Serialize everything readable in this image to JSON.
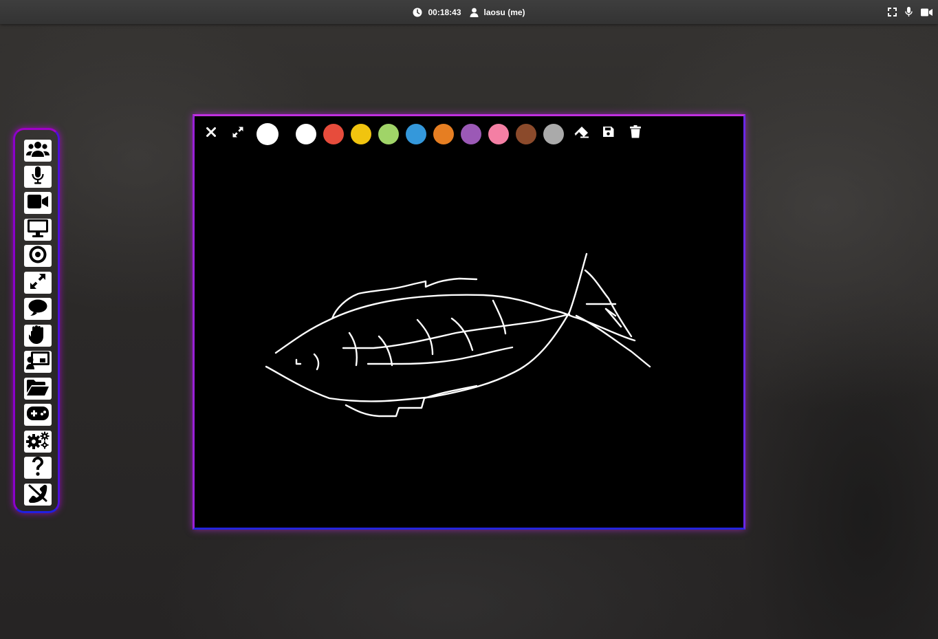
{
  "header": {
    "timer": "00:18:43",
    "user": "laosu (me)",
    "icons": [
      "clock-icon",
      "user-icon",
      "fullscreen-icon",
      "microphone-icon",
      "video-camera-icon"
    ]
  },
  "sidebar": {
    "items": [
      {
        "name": "participants-icon"
      },
      {
        "name": "microphone-icon"
      },
      {
        "name": "video-camera-icon"
      },
      {
        "name": "screen-share-icon"
      },
      {
        "name": "record-icon"
      },
      {
        "name": "fullscreen-icon"
      },
      {
        "name": "chat-icon"
      },
      {
        "name": "raise-hand-icon"
      },
      {
        "name": "whiteboard-icon"
      },
      {
        "name": "folder-open-icon"
      },
      {
        "name": "gamepad-icon"
      },
      {
        "name": "settings-icon"
      },
      {
        "name": "help-icon"
      },
      {
        "name": "hang-up-icon"
      }
    ]
  },
  "whiteboard": {
    "current_color": "#ffffff",
    "stroke_color": "#ffffff",
    "background": "#000000",
    "tools": [
      "close-icon",
      "expand-icon",
      "eraser-icon",
      "save-icon",
      "trash-icon"
    ],
    "palette": [
      "#ffffff",
      "#e74c3c",
      "#f1c40f",
      "#a0d468",
      "#3498db",
      "#e67e22",
      "#9b59b6",
      "#f47fa4",
      "#8b4a2b",
      "#aaaaaa"
    ]
  },
  "colors": {
    "frame_purple": "#b000e0",
    "frame_blue": "#2020e0"
  }
}
